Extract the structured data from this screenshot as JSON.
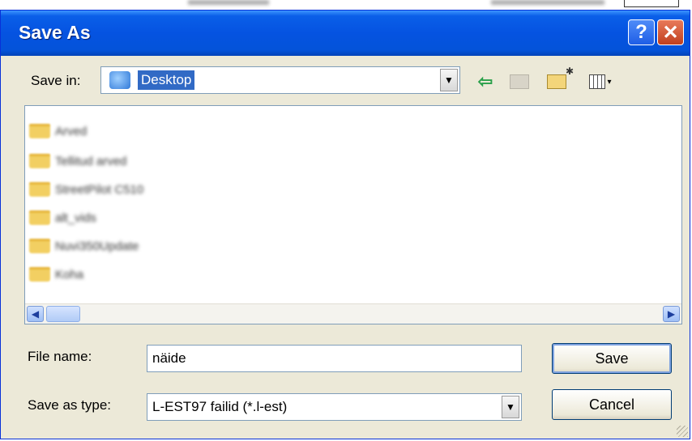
{
  "window": {
    "title": "Save As"
  },
  "title_buttons": {
    "help": "?",
    "close": "✕"
  },
  "save_in": {
    "label": "Save in:",
    "value": "Desktop"
  },
  "toolbar": {
    "back": "⇦",
    "views_caret": "▾"
  },
  "dropdown_arrow": "▼",
  "file_list": {
    "items": [
      "Arved",
      "Tellitud arved",
      "StreetPilot C510",
      "alt_vids",
      "Nuvi350Update",
      "Koha"
    ]
  },
  "scroll": {
    "left": "◀",
    "right": "▶"
  },
  "file_name": {
    "label": "File name:",
    "value": "näide"
  },
  "save_type": {
    "label": "Save as type:",
    "value": "L-EST97 failid (*.l-est)"
  },
  "buttons": {
    "save": "Save",
    "cancel": "Cancel"
  },
  "colors": {
    "title_blue": "#0553e1",
    "dialog_bg": "#ece9d8",
    "selection": "#316ac5"
  }
}
